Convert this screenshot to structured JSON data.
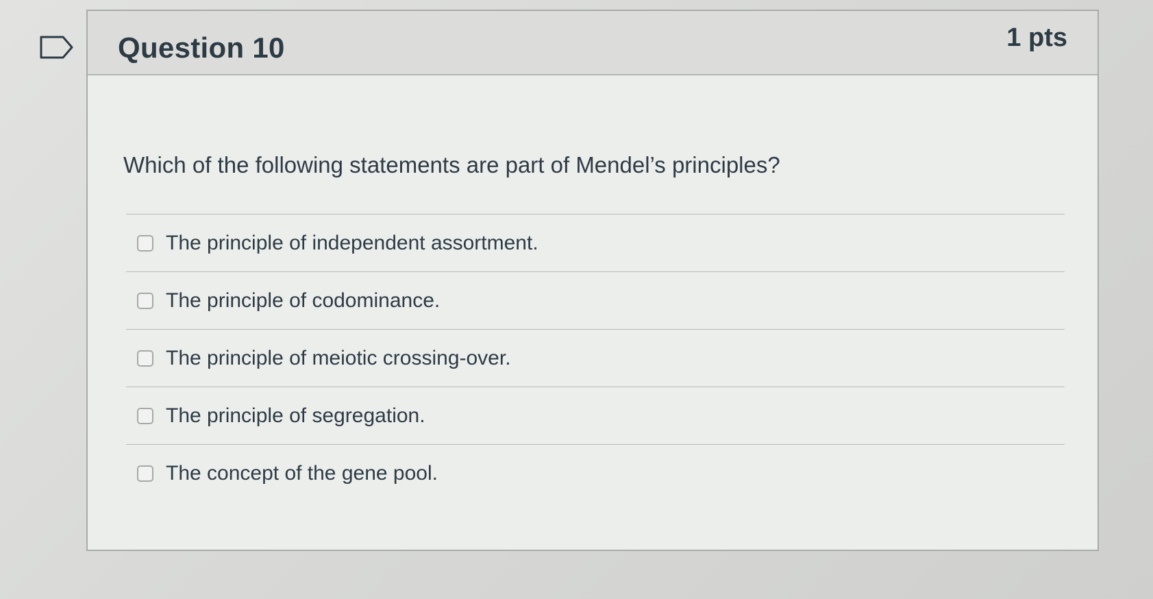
{
  "flag_icon": "bookmark-flag-icon",
  "question": {
    "title": "Question 10",
    "points": "1 pts",
    "text": "Which of the following statements are part of Mendel’s principles?"
  },
  "answers": [
    {
      "label": "The principle of independent assortment.",
      "checked": false
    },
    {
      "label": "The principle of codominance.",
      "checked": false
    },
    {
      "label": "The principle of meiotic crossing-over.",
      "checked": false
    },
    {
      "label": "The principle of segregation.",
      "checked": false
    },
    {
      "label": "The concept of the gene pool.",
      "checked": false
    }
  ]
}
